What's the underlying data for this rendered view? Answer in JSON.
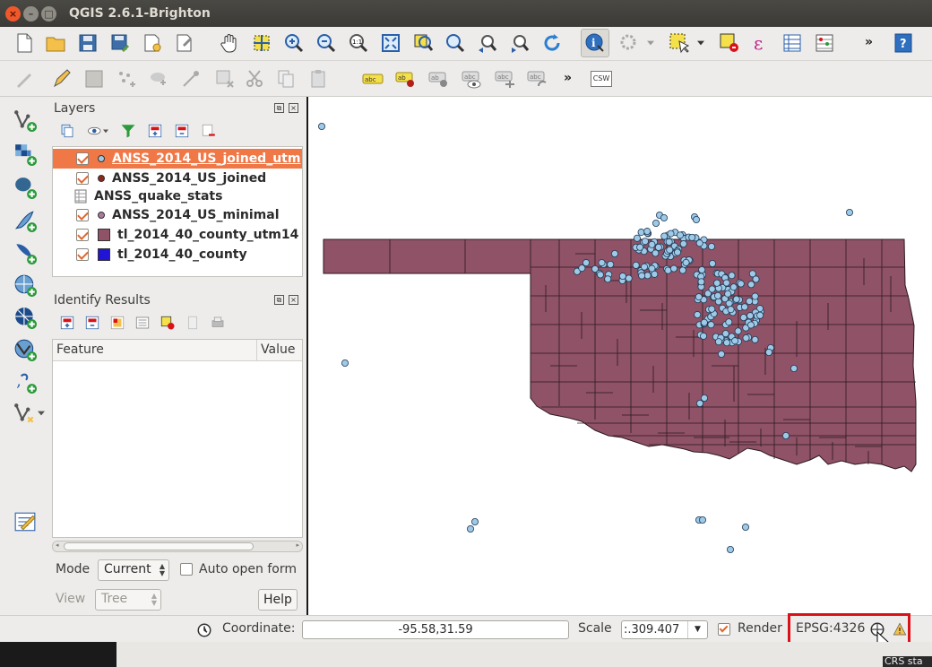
{
  "window": {
    "title": "QGIS 2.6.1-Brighton"
  },
  "layers_panel": {
    "title": "Layers",
    "layers": [
      {
        "name": "ANSS_2014_US_joined_utm",
        "checked": true,
        "symbol": "circle",
        "color": "#9ecae8",
        "selected": true
      },
      {
        "name": "ANSS_2014_US_joined",
        "checked": true,
        "symbol": "circle",
        "color": "#8b2a1a",
        "selected": false
      },
      {
        "name": "ANSS_quake_stats",
        "checked": false,
        "symbol": "table",
        "color": "",
        "selected": false
      },
      {
        "name": "ANSS_2014_US_minimal",
        "checked": true,
        "symbol": "circle",
        "color": "#a97a9a",
        "selected": false
      },
      {
        "name": "tl_2014_40_county_utm14",
        "checked": true,
        "symbol": "square",
        "color": "#8f5266",
        "selected": false
      },
      {
        "name": "tl_2014_40_county",
        "checked": true,
        "symbol": "square",
        "color": "#2214d6",
        "selected": false
      }
    ]
  },
  "identify_panel": {
    "title": "Identify Results",
    "columns": [
      "Feature",
      "Value"
    ],
    "mode_label": "Mode",
    "mode_value": "Current",
    "auto_open_label": "Auto open form",
    "view_label": "View",
    "view_value": "Tree",
    "help_label": "Help"
  },
  "statusbar": {
    "coordinate_label": "Coordinate:",
    "coordinate_value": "-95.58,31.59",
    "scale_label": "Scale",
    "scale_value": ":.309.407",
    "render_label": "Render",
    "render_checked": true,
    "crs": "EPSG:4326"
  },
  "toolbar": {
    "more": "»",
    "csw_label": "CSW"
  },
  "tooltip": "CRS sta",
  "colors": {
    "selection": "#f07746",
    "county_fill": "#8f5266",
    "quake_point": "#9ecae8",
    "highlight_box": "#d9121a"
  }
}
